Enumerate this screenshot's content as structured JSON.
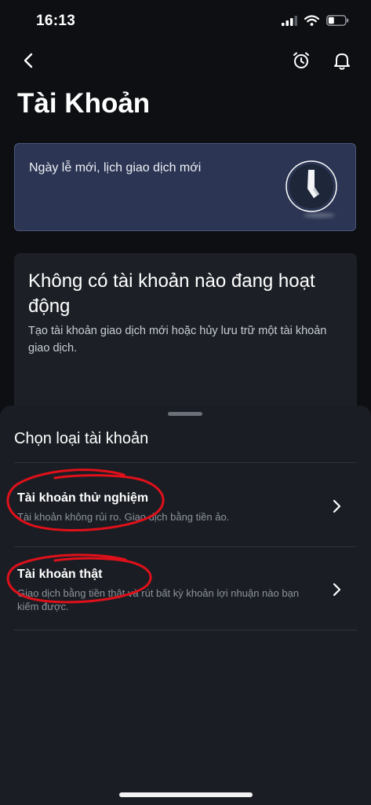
{
  "status_bar": {
    "time": "16:13"
  },
  "nav": {
    "icons": [
      "back-arrow-icon",
      "alarm-clock-icon",
      "bell-icon"
    ]
  },
  "page": {
    "title": "Tài Khoản"
  },
  "banner": {
    "text": "Ngày lễ mới, lịch giao dịch mới",
    "icon": "clock-icon",
    "accent": "#2c3654"
  },
  "empty_state": {
    "title": "Không có tài khoản nào đang hoạt động",
    "description": "Tạo tài khoản giao dịch mới hoặc hủy lưu trữ một tài khoản giao dịch."
  },
  "sheet": {
    "title": "Chọn loại tài khoản",
    "options": [
      {
        "title": "Tài khoản thử nghiệm",
        "description": "Tài khoản không rủi ro. Giao dịch bằng tiền ảo."
      },
      {
        "title": "Tài khoản thật",
        "description": "Giao dịch bằng tiền thật và rút bất kỳ khoản lợi nhuận nào bạn kiếm được."
      }
    ]
  },
  "colors": {
    "background": "#0d0f13",
    "sheet": "#1a1e24",
    "annotation": "#e0101a"
  }
}
